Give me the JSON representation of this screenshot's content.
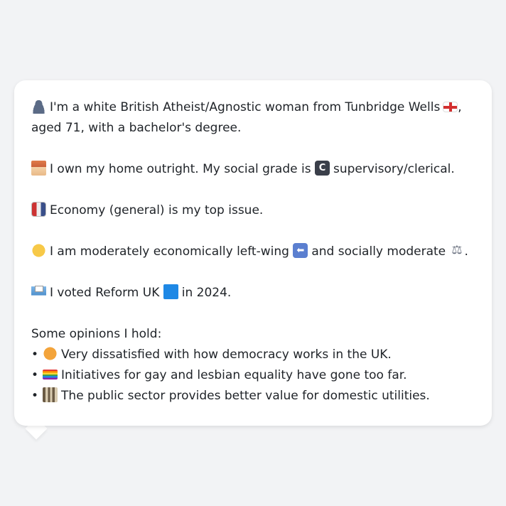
{
  "profile": {
    "line1_a": "I'm a white British Atheist/Agnostic woman from Tunbridge Wells",
    "line1_b": ",",
    "line2": "aged 71, with a bachelor's degree.",
    "home_a": "I own my home outright. My social grade is",
    "home_b": "supervisory/clerical.",
    "issue": "Economy (general) is my top issue.",
    "politics_a": "I am moderately economically left-wing",
    "politics_b": "and socially moderate",
    "politics_c": ".",
    "vote_a": "I voted Reform UK",
    "vote_b": "in 2024."
  },
  "opinions": {
    "heading": "Some opinions I hold:",
    "bullet": "•",
    "items": [
      {
        "text": "Very dissatisfied with how democracy works in the UK.",
        "icon": "angry-face-icon"
      },
      {
        "text": "Initiatives for gay and lesbian equality have gone too far.",
        "icon": "rainbow-flag-icon"
      },
      {
        "text": "The public sector provides better value for domestic utilities.",
        "icon": "classical-building-icon"
      }
    ]
  },
  "icons": {
    "person": "person-silhouette-icon",
    "flag": "england-flag-icon",
    "home": "house-icon",
    "grade": "c-letter-icon",
    "issue": "economy-icon",
    "thinking": "thinking-face-icon",
    "left": "left-arrow-icon",
    "scale": "balance-scale-icon",
    "ballot": "ballot-box-icon",
    "party": "blue-square-icon"
  },
  "colors": {
    "background": "#f2f3f5",
    "bubble": "#ffffff",
    "text": "#1f2328",
    "party_square": "#1e88e5"
  }
}
